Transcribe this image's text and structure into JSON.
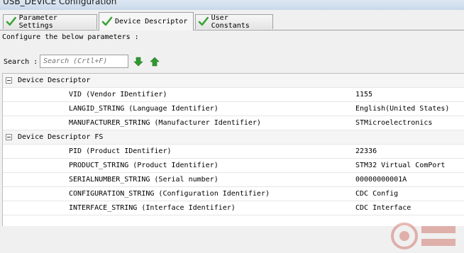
{
  "window": {
    "title": "USB_DEVICE Configuration"
  },
  "tabs": [
    {
      "label": "Parameter Settings",
      "active": false
    },
    {
      "label": "Device Descriptor",
      "active": true
    },
    {
      "label": "User Constants",
      "active": false
    }
  ],
  "main": {
    "configure_text": "Configure the below parameters :",
    "search_label": "Search :",
    "search_placeholder": "Search (Crtl+F)",
    "search_value": ""
  },
  "groups": [
    {
      "name": "Device Descriptor",
      "params": [
        {
          "name": "VID (Vendor IDentifier)",
          "value": "1155"
        },
        {
          "name": "LANGID_STRING (Language Identifier)",
          "value": "English(United States)"
        },
        {
          "name": "MANUFACTURER_STRING (Manufacturer Identifier)",
          "value": "STMicroelectronics"
        }
      ]
    },
    {
      "name": "Device Descriptor FS",
      "params": [
        {
          "name": "PID (Product IDentifier)",
          "value": "22336"
        },
        {
          "name": "PRODUCT_STRING (Product Identifier)",
          "value": "STM32 Virtual ComPort"
        },
        {
          "name": "SERIALNUMBER_STRING (Serial number)",
          "value": "00000000001A"
        },
        {
          "name": "CONFIGURATION_STRING (Configuration Identifier)",
          "value": "CDC Config"
        },
        {
          "name": "INTERFACE_STRING (Interface Identifier)",
          "value": "CDC Interface"
        }
      ]
    }
  ],
  "colors": {
    "check_green": "#3aa335",
    "arrow_green": "#2e9b2e"
  },
  "icons": {
    "tab": "checkmark-icon",
    "search_down": "arrow-down-icon",
    "search_up": "arrow-up-icon",
    "expander": "collapse-icon"
  }
}
